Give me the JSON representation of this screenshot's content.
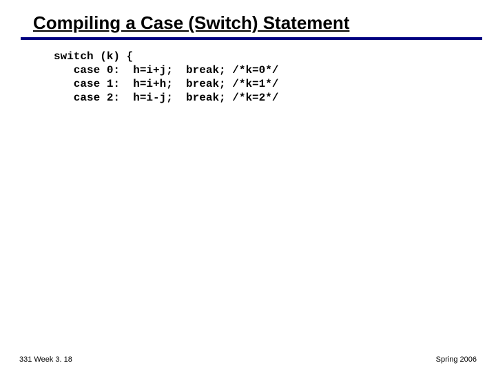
{
  "heading": "Compiling a Case (Switch) Statement",
  "code": "switch (k) {\n   case 0:  h=i+j;  break; /*k=0*/\n   case 1:  h=i+h;  break; /*k=1*/\n   case 2:  h=i-j;  break; /*k=2*/",
  "footer_left": "331 Week 3. 18",
  "footer_right": "Spring 2006"
}
